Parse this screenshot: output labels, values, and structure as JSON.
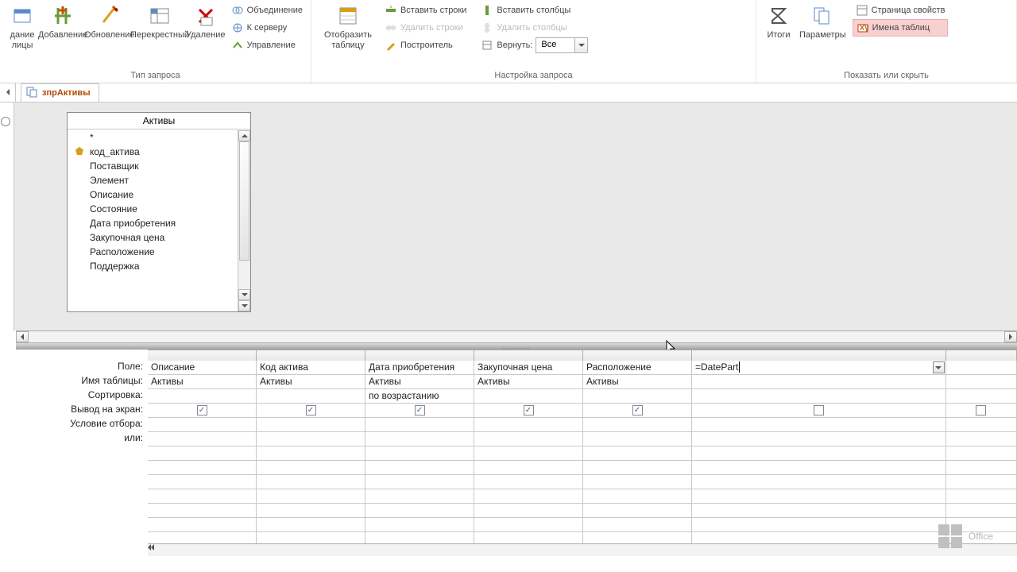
{
  "ribbon": {
    "type_group_label": "Тип запроса",
    "setup_group_label": "Настройка запроса",
    "show_group_label": "Показать или скрыть",
    "btn_make_table": "дание\nлицы",
    "btn_append": "Добавление",
    "btn_update": "Обновление",
    "btn_crosstab": "Перекрестный",
    "btn_delete": "Удаление",
    "btn_union": "Объединение",
    "btn_server": "К серверу",
    "btn_manage": "Управление",
    "btn_show_table": "Отобразить\nтаблицу",
    "btn_insert_rows": "Вставить строки",
    "btn_delete_rows": "Удалить строки",
    "btn_builder": "Построитель",
    "btn_insert_cols": "Вставить столбцы",
    "btn_delete_cols": "Удалить столбцы",
    "btn_return": "Вернуть:",
    "return_value": "Все",
    "btn_totals": "Итоги",
    "btn_params": "Параметры",
    "btn_propsheet": "Страница свойств",
    "btn_tablenames": "Имена таблиц"
  },
  "tab": {
    "name": "зпрАктивы"
  },
  "table": {
    "title": "Активы",
    "fields": [
      "*",
      "код_актива",
      "Поставщик",
      "Элемент",
      "Описание",
      "Состояние",
      "Дата приобретения",
      "Закупочная цена",
      "Расположение",
      "Поддержка"
    ]
  },
  "gridlabels": {
    "field": "Поле:",
    "table": "Имя таблицы:",
    "sort": "Сортировка:",
    "show": "Вывод на экран:",
    "criteria": "Условие отбора:",
    "or": "или:"
  },
  "columns": [
    {
      "field": "Описание",
      "table": "Активы",
      "sort": "",
      "show": true
    },
    {
      "field": "Код актива",
      "table": "Активы",
      "sort": "",
      "show": true
    },
    {
      "field": "Дата приобретения",
      "table": "Активы",
      "sort": "по возрастанию",
      "show": true
    },
    {
      "field": "Закупочная цена",
      "table": "Активы",
      "sort": "",
      "show": true
    },
    {
      "field": "Расположение",
      "table": "Активы",
      "sort": "",
      "show": true
    },
    {
      "field": "=DatePart",
      "table": "",
      "sort": "",
      "show": false,
      "active": true
    },
    {
      "field": "",
      "table": "",
      "sort": "",
      "show": false
    }
  ],
  "watermark": "Office"
}
